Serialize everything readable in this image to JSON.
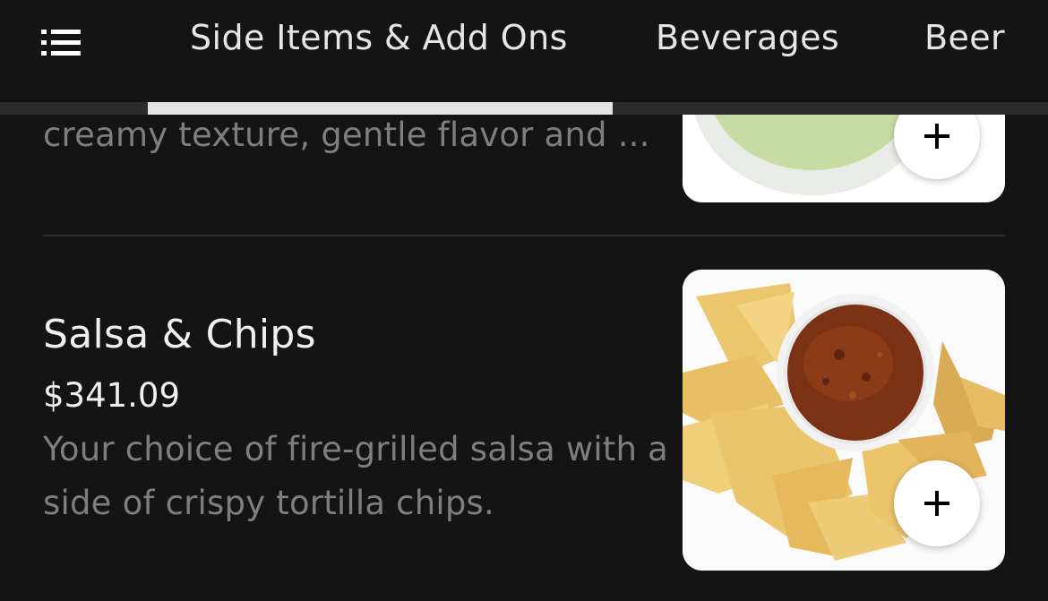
{
  "header": {
    "menu_icon": "list-menu-icon",
    "tabs": [
      {
        "label": "Side Items & Add Ons",
        "active": true
      },
      {
        "label": "Beverages",
        "active": false
      },
      {
        "label": "Beer",
        "active": false
      }
    ]
  },
  "items": [
    {
      "description_partial": "creamy texture, gentle flavor and ...",
      "image": "guacamole-bowl-image",
      "add_icon": "plus-icon"
    },
    {
      "title": "Salsa & Chips",
      "price": "$341.09",
      "description": "Your choice of fire-grilled salsa with a side of crispy tortilla chips.",
      "image": "salsa-and-chips-image",
      "add_icon": "plus-icon"
    }
  ],
  "colors": {
    "background": "#141414",
    "text_primary": "#efefef",
    "text_secondary": "#7e7e7e",
    "tab_indicator": "#e3e3e3"
  }
}
